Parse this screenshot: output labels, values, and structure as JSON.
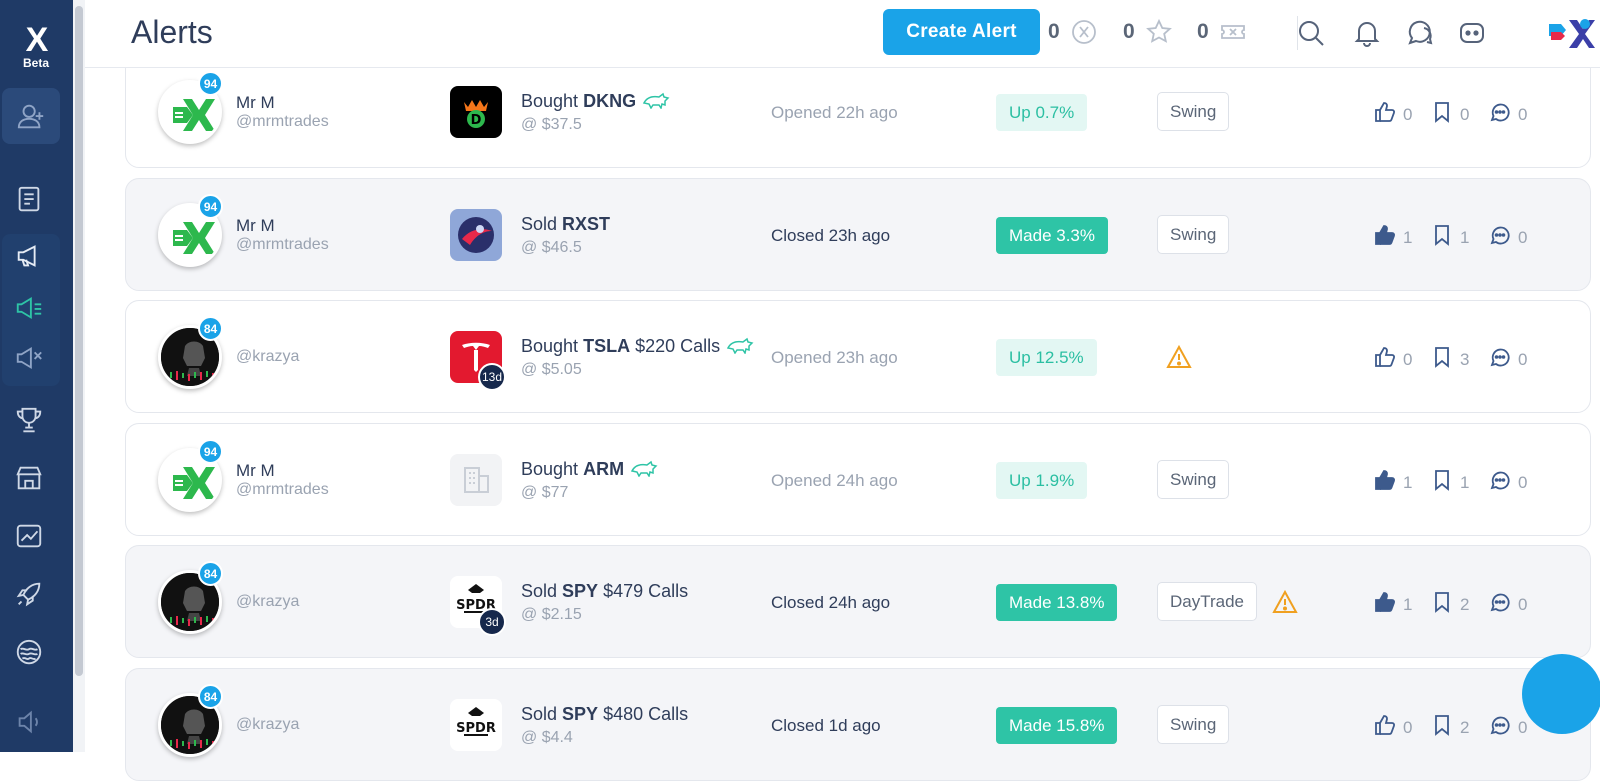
{
  "app": {
    "logo_text": "X",
    "beta_label": "Beta"
  },
  "header": {
    "title": "Alerts",
    "create_button": "Create Alert",
    "stats": [
      {
        "value": "0",
        "icon": "x-coin-icon"
      },
      {
        "value": "0",
        "icon": "star-icon"
      },
      {
        "value": "0",
        "icon": "ticket-icon"
      }
    ]
  },
  "sidebar": {
    "items": [
      "add-user-icon",
      "journal-icon",
      "megaphone-icon",
      "megaphone-list-icon",
      "megaphone-off-icon",
      "trophy-icon",
      "store-icon",
      "chart-icon",
      "rocket-icon",
      "waves-icon",
      "volume-icon"
    ]
  },
  "alerts": [
    {
      "name": "Mr M",
      "handle": "@mrmtrades",
      "score": "94",
      "action": "Bought",
      "ticker": "DKNG",
      "extra": "",
      "price": "@ $37.5",
      "status": "Opened 22h ago",
      "perf": "Up 0.7%",
      "tag": "Swing",
      "likes": "0",
      "saves": "0",
      "comments": "0",
      "days": ""
    },
    {
      "name": "Mr M",
      "handle": "@mrmtrades",
      "score": "94",
      "action": "Sold",
      "ticker": "RXST",
      "extra": "",
      "price": "@ $46.5",
      "status": "Closed 23h ago",
      "perf": "Made 3.3%",
      "tag": "Swing",
      "likes": "1",
      "saves": "1",
      "comments": "0",
      "days": ""
    },
    {
      "name": "",
      "handle": "@krazya",
      "score": "84",
      "action": "Bought",
      "ticker": "TSLA",
      "extra": "$220 Calls",
      "price": "@ $5.05",
      "status": "Opened 23h ago",
      "perf": "Up 12.5%",
      "tag": "",
      "likes": "0",
      "saves": "3",
      "comments": "0",
      "days": "13d"
    },
    {
      "name": "Mr M",
      "handle": "@mrmtrades",
      "score": "94",
      "action": "Bought",
      "ticker": "ARM",
      "extra": "",
      "price": "@ $77",
      "status": "Opened 24h ago",
      "perf": "Up 1.9%",
      "tag": "Swing",
      "likes": "1",
      "saves": "1",
      "comments": "0",
      "days": ""
    },
    {
      "name": "",
      "handle": "@krazya",
      "score": "84",
      "action": "Sold",
      "ticker": "SPY",
      "extra": "$479 Calls",
      "price": "@ $2.15",
      "status": "Closed 24h ago",
      "perf": "Made 13.8%",
      "tag": "DayTrade",
      "likes": "1",
      "saves": "2",
      "comments": "0",
      "days": "3d"
    },
    {
      "name": "",
      "handle": "@krazya",
      "score": "84",
      "action": "Sold",
      "ticker": "SPY",
      "extra": "$480 Calls",
      "price": "@ $4.4",
      "status": "Closed 1d ago",
      "perf": "Made 15.8%",
      "tag": "Swing",
      "likes": "0",
      "saves": "2",
      "comments": "0",
      "days": ""
    }
  ],
  "logos": {
    "dkng": "D",
    "spdr": "SPDR"
  },
  "colors": {
    "sidebar": "#1f3a66",
    "accent": "#1aa3e8",
    "up": "#2bbfa2",
    "warning": "#f0a020"
  }
}
